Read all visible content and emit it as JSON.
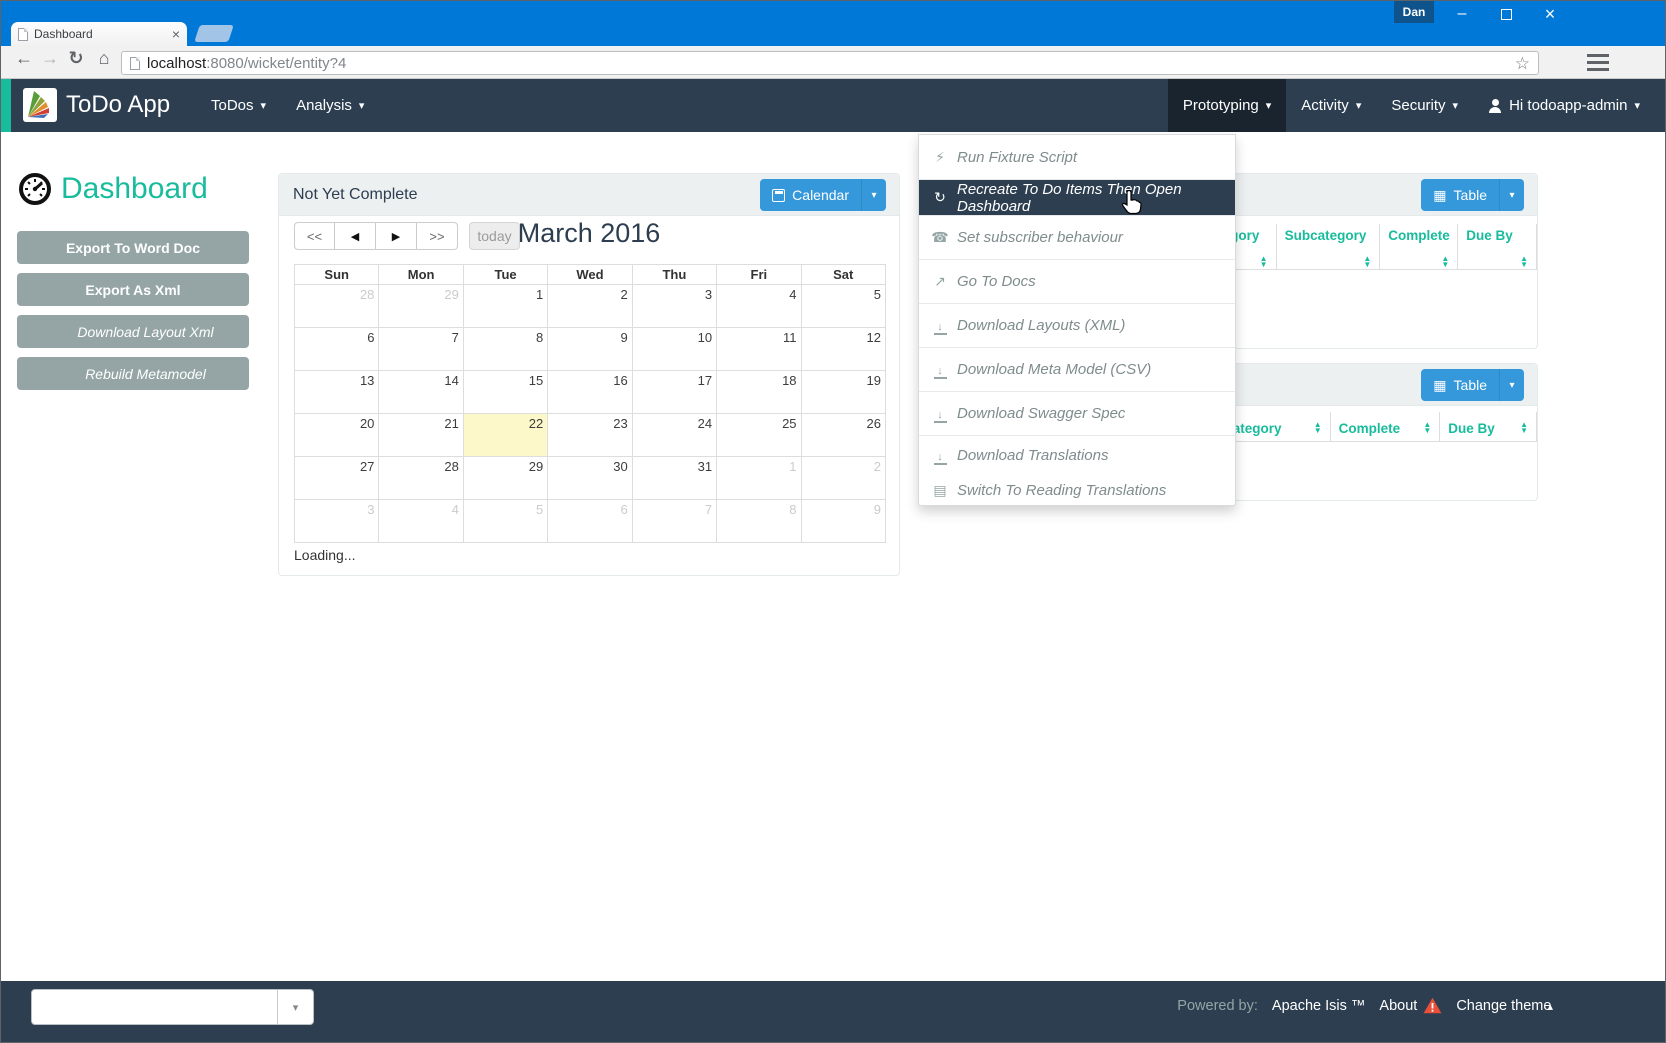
{
  "browser": {
    "tab_title": "Dashboard",
    "url_host": "localhost",
    "url_rest": ":8080/wicket/entity?4",
    "profile_name": "Dan"
  },
  "navbar": {
    "brand": "ToDo App",
    "left_items": [
      {
        "label": "ToDos"
      },
      {
        "label": "Analysis"
      }
    ],
    "right_items": [
      {
        "label": "Prototyping",
        "active": true
      },
      {
        "label": "Activity"
      },
      {
        "label": "Security"
      },
      {
        "label": "Hi todoapp-admin",
        "icon": "person"
      }
    ]
  },
  "dropdown": {
    "items": [
      {
        "icon": "lightning",
        "label": "Run Fixture Script"
      },
      {
        "icon": "refresh",
        "label": "Recreate To Do Items Then Open Dashboard",
        "highlighted": true
      },
      {
        "icon": "phone",
        "label": "Set subscriber behaviour"
      },
      {
        "icon": "external-link",
        "label": "Go To Docs"
      },
      {
        "icon": "download",
        "label": "Download Layouts (XML)"
      },
      {
        "icon": "download",
        "label": "Download Meta Model (CSV)"
      },
      {
        "icon": "download",
        "label": "Download Swagger Spec"
      },
      {
        "icon": "download",
        "label": "Download Translations",
        "short": true
      },
      {
        "icon": "book",
        "label": "Switch To Reading Translations",
        "no_sep_before": true,
        "short2": true
      }
    ]
  },
  "sidebar": {
    "title": "Dashboard",
    "buttons": [
      {
        "label": "Export To Word Doc",
        "bold": true
      },
      {
        "label": "Export As Xml",
        "bold": true
      },
      {
        "label": "Download Layout Xml",
        "icon": "download",
        "italic": true
      },
      {
        "label": "Rebuild Metamodel",
        "icon": "trash",
        "italic": true
      }
    ]
  },
  "calendar_panel": {
    "title": "Not Yet Complete",
    "view_button": "Calendar",
    "nav": [
      "<<",
      "◀",
      "▶",
      ">>"
    ],
    "today_label": "today",
    "month_title": "March 2016",
    "day_headers": [
      "Sun",
      "Mon",
      "Tue",
      "Wed",
      "Thu",
      "Fri",
      "Sat"
    ],
    "weeks": [
      [
        {
          "d": 28,
          "o": 1
        },
        {
          "d": 29,
          "o": 1
        },
        {
          "d": 1
        },
        {
          "d": 2
        },
        {
          "d": 3
        },
        {
          "d": 4
        },
        {
          "d": 5
        }
      ],
      [
        {
          "d": 6
        },
        {
          "d": 7
        },
        {
          "d": 8
        },
        {
          "d": 9
        },
        {
          "d": 10
        },
        {
          "d": 11
        },
        {
          "d": 12
        }
      ],
      [
        {
          "d": 13
        },
        {
          "d": 14
        },
        {
          "d": 15
        },
        {
          "d": 16
        },
        {
          "d": 17
        },
        {
          "d": 18
        },
        {
          "d": 19
        }
      ],
      [
        {
          "d": 20
        },
        {
          "d": 21
        },
        {
          "d": 22,
          "t": 1
        },
        {
          "d": 23
        },
        {
          "d": 24
        },
        {
          "d": 25
        },
        {
          "d": 26
        }
      ],
      [
        {
          "d": 27
        },
        {
          "d": 28
        },
        {
          "d": 29
        },
        {
          "d": 30
        },
        {
          "d": 31
        },
        {
          "d": 1,
          "o": 1
        },
        {
          "d": 2,
          "o": 1
        }
      ],
      [
        {
          "d": 3,
          "o": 1
        },
        {
          "d": 4,
          "o": 1
        },
        {
          "d": 5,
          "o": 1
        },
        {
          "d": 6,
          "o": 1
        },
        {
          "d": 7,
          "o": 1
        },
        {
          "d": 8,
          "o": 1
        },
        {
          "d": 9,
          "o": 1
        }
      ]
    ],
    "loading_text": "Loading..."
  },
  "tables": [
    {
      "button": "Table",
      "columns": [
        {
          "label": "Category"
        },
        {
          "label": "Subcategory"
        },
        {
          "label": "Complete"
        },
        {
          "label": "Due By"
        }
      ]
    },
    {
      "button": "Table",
      "columns": [
        {
          "label": "Category"
        },
        {
          "label": "Complete"
        },
        {
          "label": "Due By"
        }
      ]
    }
  ],
  "footer": {
    "powered_by": "Powered by:",
    "brand": "Apache Isis ™",
    "about": "About",
    "change_theme": "Change theme"
  },
  "icons": {
    "lightning": "⚡",
    "refresh": "↻",
    "phone": "☎",
    "external-link": "↗",
    "book": "▤",
    "caret-down": "▾",
    "caret-up": "▴",
    "sort-up": "▲",
    "sort-down": "▼",
    "star": "☆",
    "home": "⌂",
    "back": "←",
    "forward": "→",
    "reload": "↻",
    "close": "×",
    "minimize": "–"
  },
  "colors": {
    "titlebar_blue": "#0078d7",
    "navbar": "#2c3e50",
    "accent_teal": "#18bc9c",
    "button_blue": "#3498db",
    "button_grey": "#95a5a6",
    "today_highlight": "#fcf8c9",
    "warning_red": "#e8503a"
  }
}
